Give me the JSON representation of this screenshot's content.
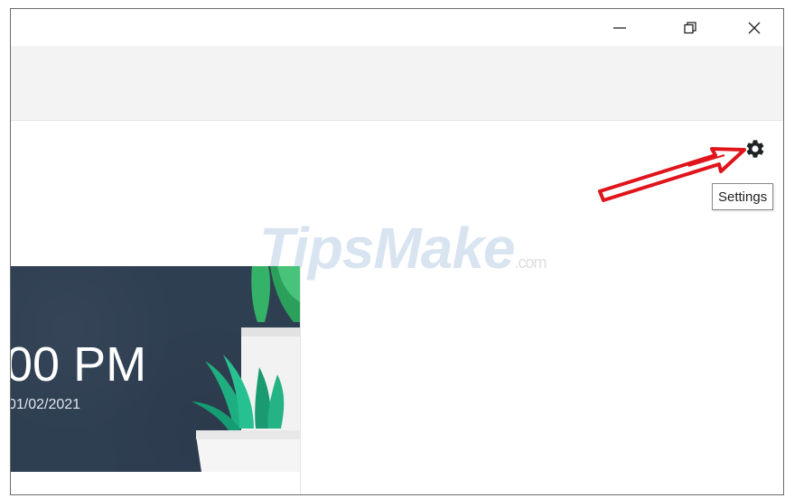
{
  "window": {
    "minimize_icon": "minimize-icon",
    "maximize_icon": "restore-icon",
    "close_icon": "close-icon"
  },
  "settings": {
    "icon": "gear-icon",
    "tooltip": "Settings"
  },
  "annotation": {
    "arrow_color": "#e0141b"
  },
  "watermark": {
    "text": "TipsMake",
    "suffix": ".com"
  },
  "clock_card": {
    "time": "00 PM",
    "date": "01/02/2021",
    "background_color": "#2f3f52"
  }
}
